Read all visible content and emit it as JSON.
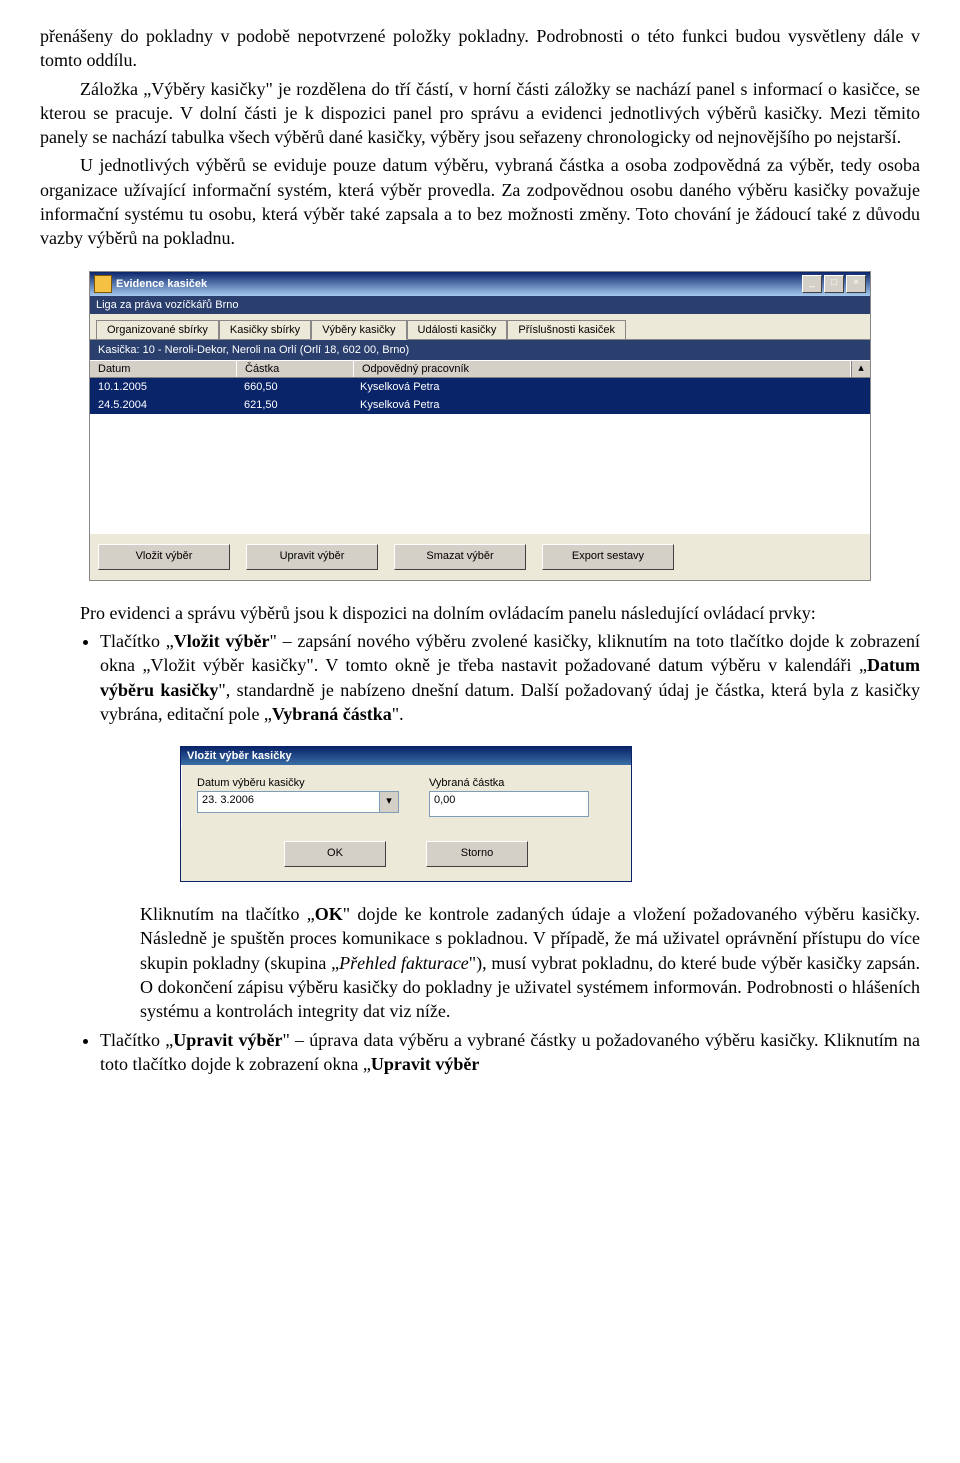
{
  "para1": "přenášeny do pokladny v podobě nepotvrzené položky pokladny. Podrobnosti o této funkci budou vysvětleny dále v tomto oddílu.",
  "para2_a": "Záložka „Výběry kasičky\" je rozdělena do tří částí, v horní části záložky se nachází panel s informací o kasičce, se kterou se pracuje. V dolní části je k dispozici panel pro správu a evidenci jednotlivých výběrů kasičky. Mezi těmito panely se nachází tabulka všech výběrů dané kasičky, výběry jsou seřazeny chronologicky od nejnovějšího po nejstarší.",
  "para3": "U jednotlivých výběrů se eviduje pouze datum výběru, vybraná částka a osoba zodpovědná za výběr, tedy osoba organizace užívající informační systém, která výběr provedla. Za zodpovědnou osobu daného výběru kasičky považuje informační systému tu osobu, která výběr také zapsala a to bez možnosti změny. Toto chování je žádoucí také z důvodu vazby výběrů na pokladnu.",
  "window": {
    "title": "Evidence kasiček",
    "subtitle": "Liga za práva vozíčkářů Brno",
    "tabs": [
      "Organizované sbírky",
      "Kasičky sbírky",
      "Výběry kasičky",
      "Události kasičky",
      "Příslušnosti kasiček"
    ],
    "info": "Kasička: 10 - Neroli-Dekor, Neroli na Orlí (Orlí 18, 602 00, Brno)",
    "columns": {
      "date": "Datum",
      "amount": "Částka",
      "person": "Odpovědný pracovník"
    },
    "rows": [
      {
        "date": "10.1.2005",
        "amount": "660,50",
        "person": "Kyselková Petra"
      },
      {
        "date": "24.5.2004",
        "amount": "621,50",
        "person": "Kyselková Petra"
      }
    ],
    "buttons": {
      "insert": "Vložit výběr",
      "edit": "Upravit výběr",
      "delete": "Smazat výběr",
      "export": "Export sestavy"
    }
  },
  "para4": "Pro evidenci a správu výběrů jsou k dispozici na dolním ovládacím panelu následující ovládací prvky:",
  "bullet1": {
    "a": "Tlačítko „",
    "b": "Vložit výběr",
    "c": "\" – zapsání nového výběru zvolené kasičky, kliknutím na toto tlačítko dojde k zobrazení okna „Vložit výběr kasičky\". V tomto okně je třeba nastavit požadované datum výběru v kalendáři „",
    "d": "Datum výběru kasičky",
    "e": "\", standardně je nabízeno dnešní datum. Další požadovaný údaj je částka, která byla z kasičky vybrána, editační pole „",
    "f": "Vybraná částka",
    "g": "\"."
  },
  "dialog": {
    "title": "Vložit výběr kasičky",
    "label1": "Datum výběru kasičky",
    "value1": "23. 3.2006",
    "label2": "Vybraná částka",
    "value2": "0,00",
    "ok": "OK",
    "cancel": "Storno"
  },
  "para5": {
    "a": "Kliknutím na tlačítko „",
    "b": "OK",
    "c": "\" dojde ke kontrole zadaných údaje a vložení požadovaného výběru kasičky. Následně je spuštěn proces komunikace s pokladnou. V případě, že má uživatel oprávnění přístupu do více skupin pokladny (skupina „",
    "d": "Přehled fakturace",
    "e": "\"), musí vybrat pokladnu, do které bude výběr kasičky zapsán. O dokončení zápisu výběru kasičky do pokladny je uživatel systémem informován. Podrobnosti o hlášeních systému a kontrolách integrity dat viz níže."
  },
  "bullet2": {
    "a": "Tlačítko „",
    "b": "Upravit výběr",
    "c": "\" – úprava data výběru a vybrané částky u požadovaného výběru kasičky. Kliknutím na toto tlačítko dojde k zobrazení okna „",
    "d": "Upravit výběr"
  }
}
